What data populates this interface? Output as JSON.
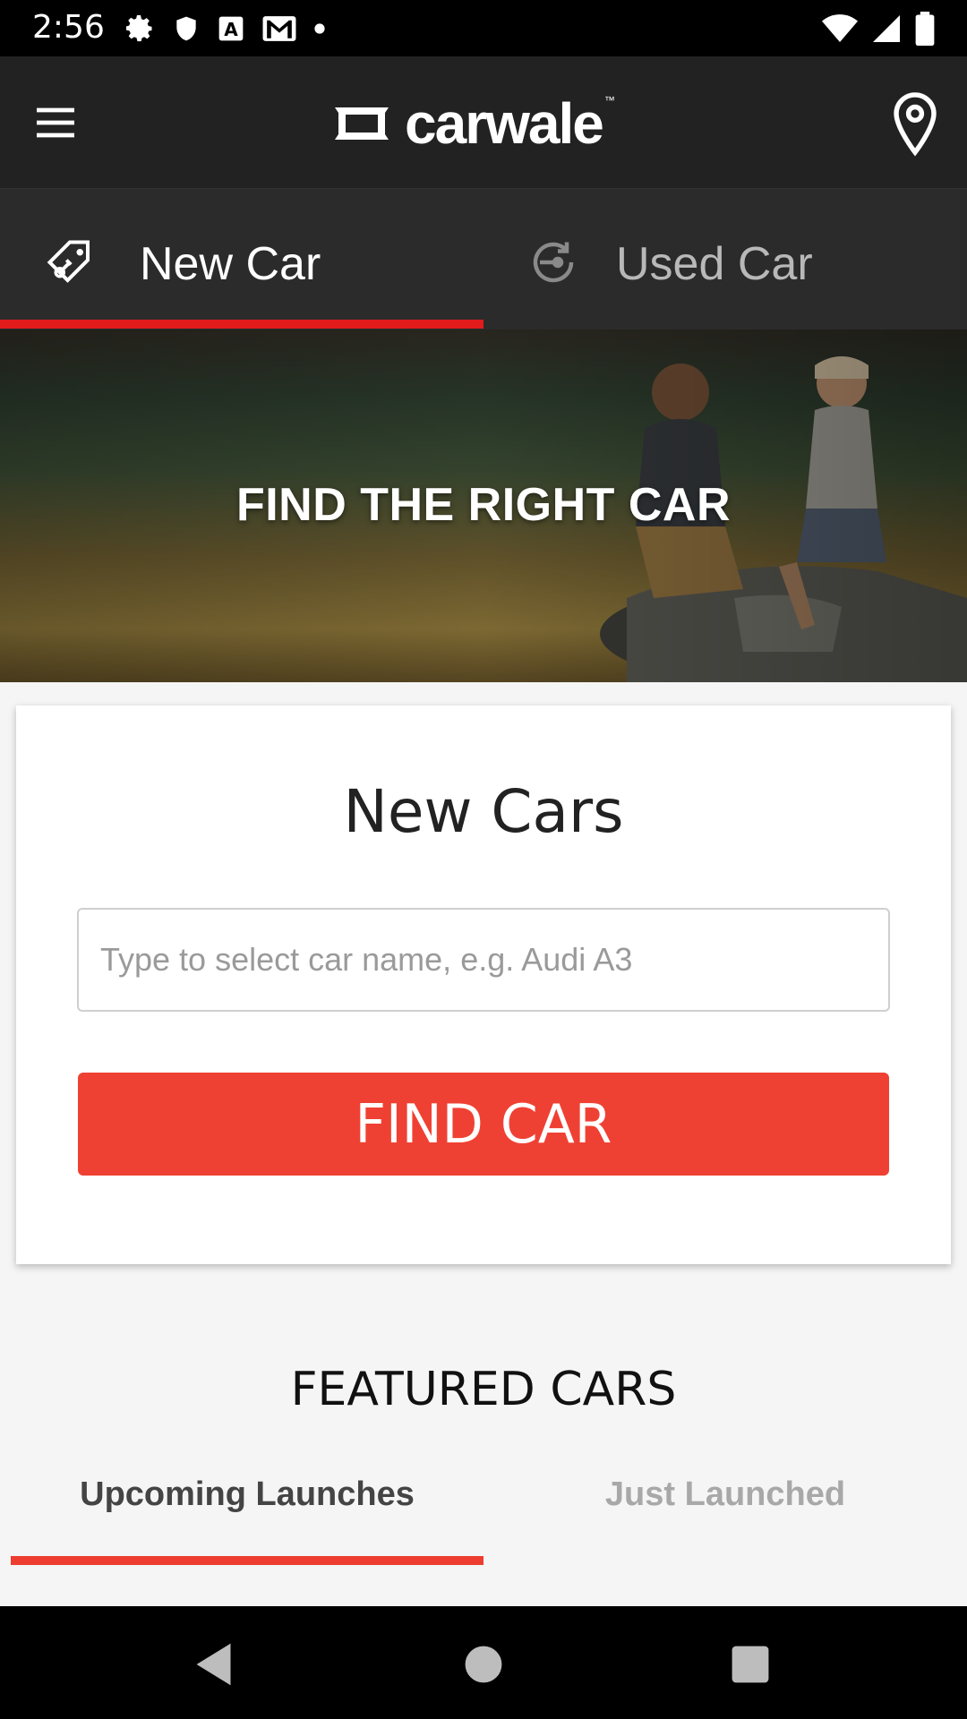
{
  "status_bar": {
    "time": "2:56"
  },
  "app_bar": {
    "logo_text": "carwale",
    "logo_tm": "™"
  },
  "tabs": [
    {
      "label": "New Car"
    },
    {
      "label": "Used Car"
    }
  ],
  "hero": {
    "title": "FIND THE RIGHT CAR"
  },
  "search_card": {
    "title": "New Cars",
    "input_placeholder": "Type to select car name, e.g. Audi A3",
    "input_value": "",
    "button_label": "FIND CAR"
  },
  "featured": {
    "title": "FEATURED CARS",
    "tabs": [
      {
        "label": "Upcoming Launches"
      },
      {
        "label": "Just Launched"
      }
    ]
  },
  "colors": {
    "accent": "#ef4133",
    "tab_indicator": "#e21b1b",
    "app_bar": "#222222",
    "tabs_bg": "#2b2b2b"
  },
  "icons": [
    "menu-icon",
    "location-pin-icon",
    "price-tag-key-icon",
    "used-car-key-icon",
    "back-icon",
    "home-icon",
    "recents-icon"
  ]
}
